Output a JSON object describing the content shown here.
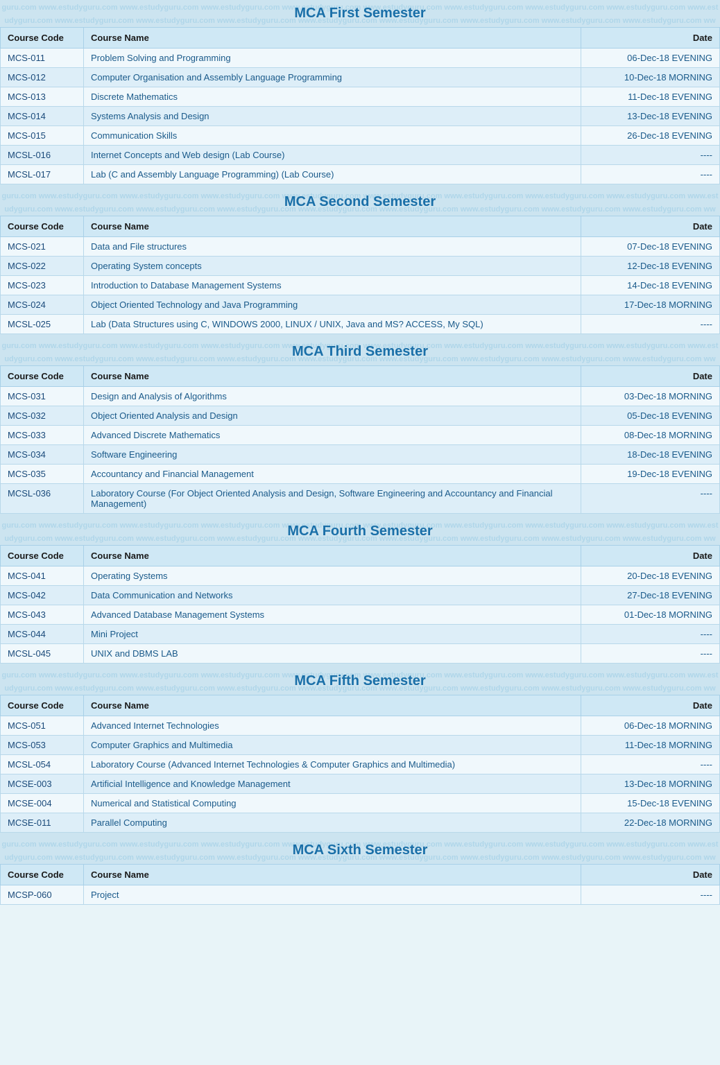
{
  "semesters": [
    {
      "title": "MCA First Semester",
      "columns": [
        "Course Code",
        "Course Name",
        "Date"
      ],
      "rows": [
        {
          "code": "MCS-011",
          "name": "Problem Solving and Programming",
          "date": "06-Dec-18  EVENING"
        },
        {
          "code": "MCS-012",
          "name": "Computer Organisation and Assembly Language Programming",
          "date": "10-Dec-18  MORNING"
        },
        {
          "code": "MCS-013",
          "name": "Discrete Mathematics",
          "date": "11-Dec-18  EVENING"
        },
        {
          "code": "MCS-014",
          "name": "Systems Analysis and Design",
          "date": "13-Dec-18  EVENING"
        },
        {
          "code": "MCS-015",
          "name": "Communication Skills",
          "date": "26-Dec-18  EVENING"
        },
        {
          "code": "MCSL-016",
          "name": "Internet Concepts and Web design (Lab Course)",
          "date": "----"
        },
        {
          "code": "MCSL-017",
          "name": "Lab (C and Assembly Language Programming) (Lab Course)",
          "date": "----"
        }
      ]
    },
    {
      "title": "MCA Second Semester",
      "columns": [
        "Course Code",
        "Course Name",
        "Date"
      ],
      "rows": [
        {
          "code": "MCS-021",
          "name": "Data and File structures",
          "date": "07-Dec-18  EVENING"
        },
        {
          "code": "MCS-022",
          "name": "Operating System concepts",
          "date": "12-Dec-18  EVENING"
        },
        {
          "code": "MCS-023",
          "name": "Introduction to Database Management Systems",
          "date": "14-Dec-18  EVENING"
        },
        {
          "code": "MCS-024",
          "name": "Object Oriented Technology and Java Programming",
          "date": "17-Dec-18  MORNING"
        },
        {
          "code": "MCSL-025",
          "name": "Lab (Data Structures using C, WINDOWS 2000, LINUX / UNIX, Java and MS? ACCESS, My SQL)",
          "date": "----"
        }
      ]
    },
    {
      "title": "MCA Third Semester",
      "columns": [
        "Course Code",
        "Course Name",
        "Date"
      ],
      "rows": [
        {
          "code": "MCS-031",
          "name": "Design and Analysis of Algorithms",
          "date": "03-Dec-18  MORNING"
        },
        {
          "code": "MCS-032",
          "name": "Object Oriented Analysis and Design",
          "date": "05-Dec-18  EVENING"
        },
        {
          "code": "MCS-033",
          "name": "Advanced Discrete Mathematics",
          "date": "08-Dec-18  MORNING"
        },
        {
          "code": "MCS-034",
          "name": "Software Engineering",
          "date": "18-Dec-18  EVENING"
        },
        {
          "code": "MCS-035",
          "name": "Accountancy and Financial Management",
          "date": "19-Dec-18  EVENING"
        },
        {
          "code": "MCSL-036",
          "name": "Laboratory Course (For Object Oriented Analysis and Design, Software Engineering and Accountancy and Financial Management)",
          "date": "----"
        }
      ]
    },
    {
      "title": "MCA Fourth Semester",
      "columns": [
        "Course Code",
        "Course Name",
        "Date"
      ],
      "rows": [
        {
          "code": "MCS-041",
          "name": "Operating Systems",
          "date": "20-Dec-18  EVENING"
        },
        {
          "code": "MCS-042",
          "name": "Data Communication and Networks",
          "date": "27-Dec-18  EVENING"
        },
        {
          "code": "MCS-043",
          "name": "Advanced Database Management Systems",
          "date": "01-Dec-18  MORNING"
        },
        {
          "code": "MCS-044",
          "name": "Mini Project",
          "date": "----"
        },
        {
          "code": "MCSL-045",
          "name": "UNIX and DBMS LAB",
          "date": "----"
        }
      ]
    },
    {
      "title": "MCA Fifth Semester",
      "columns": [
        "Course Code",
        "Course Name",
        "Date"
      ],
      "rows": [
        {
          "code": "MCS-051",
          "name": "Advanced Internet Technologies",
          "date": "06-Dec-18  MORNING"
        },
        {
          "code": "MCS-053",
          "name": "Computer Graphics and Multimedia",
          "date": "11-Dec-18  MORNING"
        },
        {
          "code": "MCSL-054",
          "name": "Laboratory Course (Advanced Internet Technologies & Computer Graphics and Multimedia)",
          "date": "----"
        },
        {
          "code": "MCSE-003",
          "name": "Artificial Intelligence and Knowledge Management",
          "date": "13-Dec-18  MORNING"
        },
        {
          "code": "MCSE-004",
          "name": "Numerical and Statistical Computing",
          "date": "15-Dec-18  EVENING"
        },
        {
          "code": "MCSE-011",
          "name": "Parallel Computing",
          "date": "22-Dec-18  MORNING"
        }
      ]
    },
    {
      "title": "MCA Sixth Semester",
      "columns": [
        "Course Code",
        "Course Name",
        "Date"
      ],
      "rows": [
        {
          "code": "MCSP-060",
          "name": "Project",
          "date": "----"
        }
      ]
    }
  ],
  "watermark": "guru.com  www.estudyguru.com  www.estudyguru.com  www.estudyguru.com  www.estudyguru.com  www.estudyguru.com  www.estudyguru.com  www.estudyguru.com  www.estudyguru.com  www.estudyguru.com  www.estudyguru.com  www.estudyguru.com  www.estudyguru.com  www.estudyguru.com  www.estudyguru.com  www.estudyguru.com  www.estudyguru.com  www.estudyguru.com  www.estudyguru.com  www.estudyguru.com  www.estudyguru.com  www.estudyguru.com  www.estudyguru.com  www.estudyguru.com  www.estudyguru.com  www.estudyguru.com  www.estudyguru.com  www.estudyguru.com  www.estudyguru.com  www.estudyguru.com  www.estudyguru.com  www.estudyguru.com  www.estudyguru.com  www.estudyguru.com  www.estudyguru.com  www.estudyguru.com  www.estudyguru.com  www.estudyguru.com  www.estudyguru.com  www.estudyguru.com  www.estudyguru.com"
}
